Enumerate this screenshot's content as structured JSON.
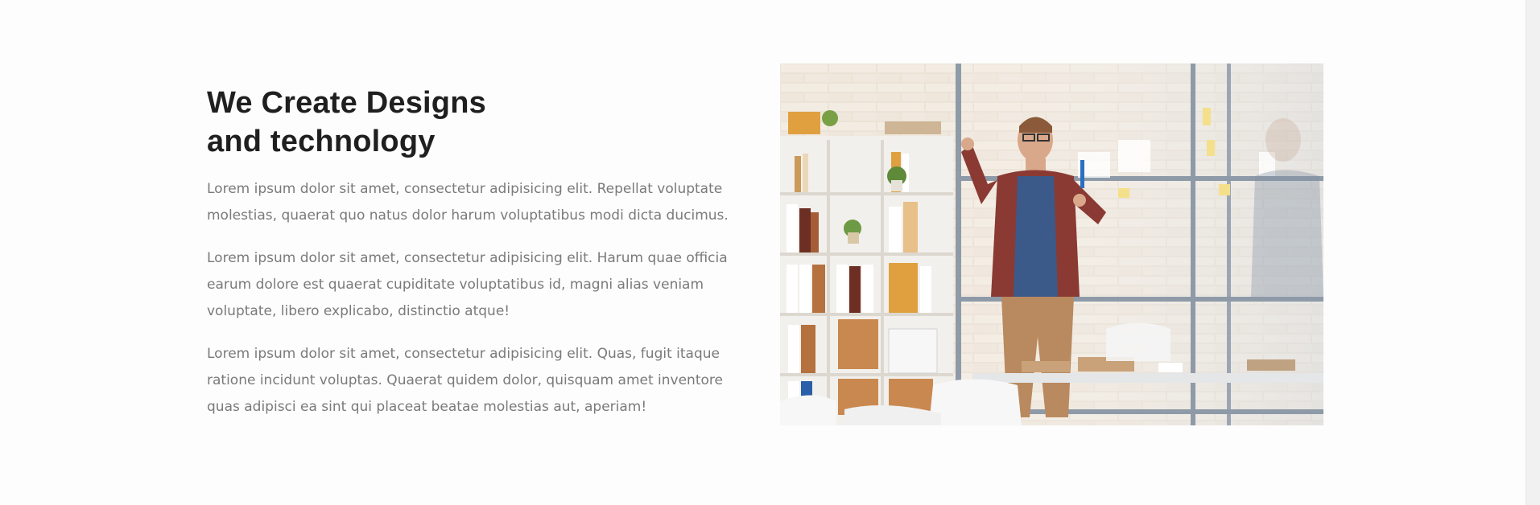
{
  "section": {
    "heading_line1": "We Create Designs",
    "heading_line2": "and technology",
    "paragraphs": [
      "Lorem ipsum dolor sit amet, consectetur adipisicing elit. Repellat voluptate molestias, quaerat quo natus dolor harum voluptatibus modi dicta ducimus.",
      "Lorem ipsum dolor sit amet, consectetur adipisicing elit. Harum quae officia earum dolore est quaerat cupiditate voluptatibus id, magni alias veniam voluptate, libero explicabo, distinctio atque!",
      "Lorem ipsum dolor sit amet, consectetur adipisicing elit. Quas, fugit itaque ratione incidunt voluptas. Quaerat quidem dolor, quisquam amet inventore quas adipisci ea sint qui placeat beatae molestias aut, aperiam!"
    ]
  },
  "image": {
    "subject": "man writing on glass wall in office",
    "colors": {
      "brick": "#e8ddd0",
      "shelf": "#f4f2ee",
      "glass_frame": "#8e9aa8",
      "shirt": "#3b5a8a",
      "pants": "#b98a5f",
      "folder_orange": "#e0a040",
      "folder_brown": "#b5713e"
    }
  },
  "theme": {
    "heading_color": "#1f1f1f",
    "text_color": "#7a7a7a",
    "background": "#fdfdfd"
  }
}
